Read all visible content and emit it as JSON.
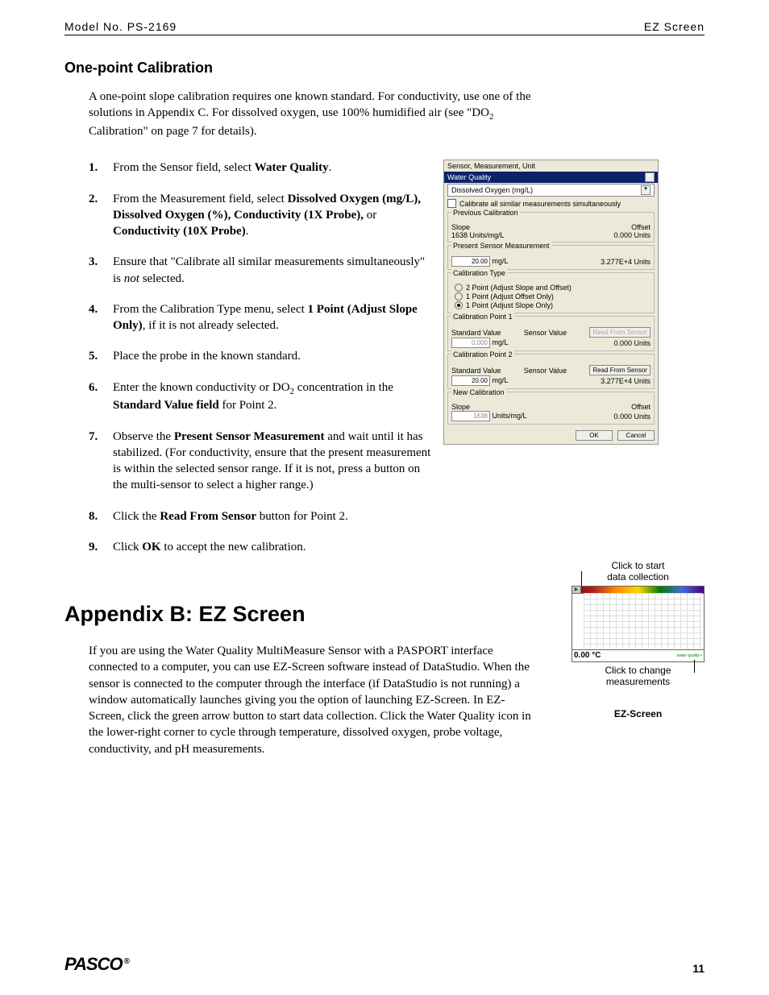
{
  "header": {
    "left": "Model No. PS-2169",
    "right": "EZ Screen"
  },
  "section1_title": "One-point Calibration",
  "intro": {
    "p1a": "A one-point slope calibration requires one known standard. For conductivity, use one of the solutions in Appendix C. For dissolved oxygen, use 100% humidified air (see \"DO",
    "sub": "2",
    "p1b": " Calibration\" on page 7 for details)."
  },
  "steps": [
    {
      "num": "1.",
      "parts": [
        "From the Sensor field, select ",
        {
          "b": "Water Quality"
        },
        "."
      ]
    },
    {
      "num": "2.",
      "parts": [
        "From the Measurement field, select ",
        {
          "b": "Dissolved Oxygen (mg/L), Dissolved Oxygen (%), Conductivity (1X Probe),"
        },
        " or ",
        {
          "b": "Conductivity (10X Probe)"
        },
        "."
      ]
    },
    {
      "num": "3.",
      "parts": [
        "Ensure that \"Calibrate all similar measurements simultaneously\" is ",
        {
          "i": "not"
        },
        " selected."
      ]
    },
    {
      "num": "4.",
      "parts": [
        "From the Calibration Type menu, select ",
        {
          "b": "1 Point (Adjust Slope Only)"
        },
        ", if it is not already selected."
      ]
    },
    {
      "num": "5.",
      "parts": [
        "Place the probe in the known standard."
      ]
    },
    {
      "num": "6.",
      "parts": [
        "Enter the known conductivity or DO",
        {
          "sub": "2"
        },
        " concentration in the ",
        {
          "b": "Standard Value field"
        },
        " for Point 2."
      ]
    },
    {
      "num": "7.",
      "parts": [
        "Observe the ",
        {
          "b": "Present Sensor Measurement"
        },
        " and wait until it has stabilized. (For conductivity, ensure that the present measurement is within the selected sensor range. If it is not, press a button on the multi-sensor to select a higher range.)"
      ]
    },
    {
      "num": "8.",
      "parts": [
        "Click the ",
        {
          "b": "Read From Sensor"
        },
        " button for Point 2."
      ]
    },
    {
      "num": "9.",
      "parts": [
        "Click ",
        {
          "b": "OK"
        },
        " to accept the new calibration."
      ]
    }
  ],
  "dialog": {
    "title": "Sensor, Measurement, Unit",
    "sensor_value": "Water Quality",
    "measurement_value": "Dissolved Oxygen (mg/L)",
    "checkbox_label": "Calibrate all similar measurements simultaneously",
    "prev_cal": {
      "title": "Previous Calibration",
      "slope_label": "Slope",
      "slope_val": "1638",
      "slope_unit": "Units/mg/L",
      "offset_label": "Offset",
      "offset_val": "0.000",
      "offset_unit": "Units"
    },
    "present": {
      "title": "Present Sensor Measurement",
      "val": "20.00",
      "unit": "mg/L",
      "val2": "3.277E+4",
      "unit2": "Units"
    },
    "cal_type": {
      "title": "Calibration Type",
      "o1": "2 Point (Adjust Slope and Offset)",
      "o2": "1 Point (Adjust Offset Only)",
      "o3": "1 Point (Adjust Slope Only)"
    },
    "p1": {
      "title": "Calibration Point 1",
      "std_label": "Standard Value",
      "std_val": "0.000",
      "std_unit": "mg/L",
      "sv_label": "Sensor Value",
      "sv_val": "0.000",
      "sv_unit": "Units",
      "btn": "Read From Sensor"
    },
    "p2": {
      "title": "Calibration Point 2",
      "std_label": "Standard Value",
      "std_val": "20.00",
      "std_unit": "mg/L",
      "sv_label": "Sensor Value",
      "sv_val": "3.277E+4",
      "sv_unit": "Units",
      "btn": "Read From Sensor"
    },
    "new_cal": {
      "title": "New Calibration",
      "slope_label": "Slope",
      "slope_val": "1638",
      "slope_unit": "Units/mg/L",
      "offset_label": "Offset",
      "offset_val": "0.000",
      "offset_unit": "Units"
    },
    "ok": "OK",
    "cancel": "Cancel"
  },
  "appendix_title": "Appendix B: EZ Screen",
  "appendix_body": "If you are using the Water Quality MultiMeasure Sensor with a PASPORT interface connected to a computer, you can use EZ-Screen software instead of DataStudio. When the sensor is connected to the computer through the interface (if DataStudio is not running) a window automatically launches giving you the option of launching EZ-Screen. In EZ-Screen, click the green arrow button to start data collection. Click the Water Quality icon in the lower-right corner to cycle through temperature, dissolved oxygen, probe voltage, conductivity, and pH measurements.",
  "ez": {
    "label_top": "Click to start\ndata collection",
    "status_value": "0.00 °C",
    "label_bottom": "Click to change\nmeasurements",
    "caption": "EZ-Screen"
  },
  "footer": {
    "logo": "PASCO",
    "page": "11"
  }
}
